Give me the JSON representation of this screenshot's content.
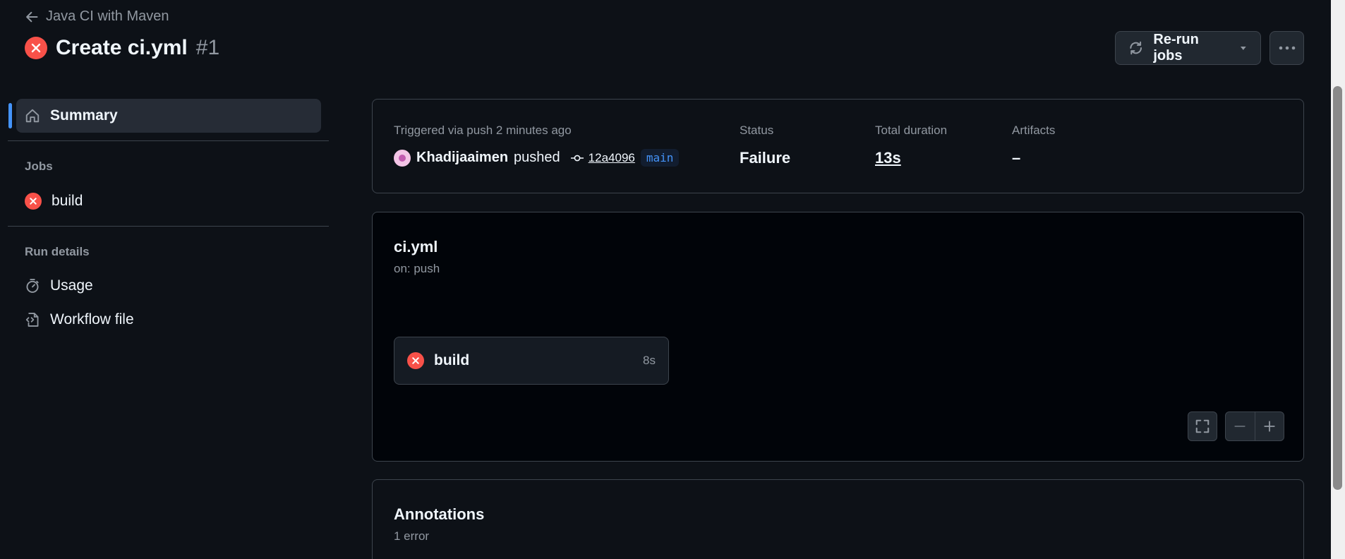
{
  "header": {
    "back_label": "Java CI with Maven",
    "run_title": "Create ci.yml",
    "run_number": "#1",
    "rerun_label": "Re-run jobs"
  },
  "sidebar": {
    "summary_label": "Summary",
    "jobs_heading": "Jobs",
    "job_label": "build",
    "run_details_heading": "Run details",
    "usage_label": "Usage",
    "workflow_file_label": "Workflow file"
  },
  "summary": {
    "trigger_text": "Triggered via push 2 minutes ago",
    "user": "Khadijaaimen",
    "action": "pushed",
    "commit": "12a4096",
    "branch": "main",
    "status_label": "Status",
    "status_value": "Failure",
    "duration_label": "Total duration",
    "duration_value": "13s",
    "artifacts_label": "Artifacts",
    "artifacts_value": "–"
  },
  "graph": {
    "workflow_name": "ci.yml",
    "trigger": "on: push",
    "job_name": "build",
    "job_duration": "8s"
  },
  "annotations": {
    "title": "Annotations",
    "count": "1 error"
  },
  "colors": {
    "failure": "#f85149",
    "accent": "#4493f8",
    "background": "#0d1117"
  }
}
